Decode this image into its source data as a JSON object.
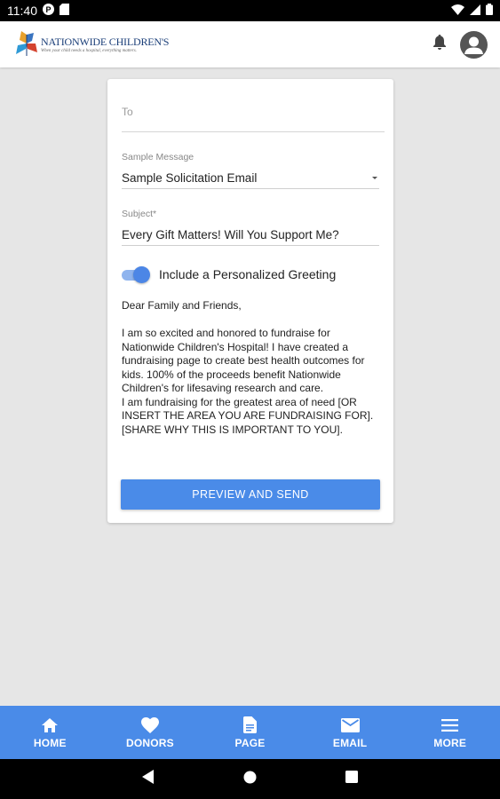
{
  "status_bar": {
    "time": "11:40"
  },
  "app_bar": {
    "logo_name": "NATIONWIDE CHILDREN'S",
    "logo_tagline": "When your child needs a hospital, everything matters."
  },
  "form": {
    "to_placeholder": "To",
    "sample_message_label": "Sample Message",
    "sample_message_value": "Sample Solicitation Email",
    "subject_label": "Subject",
    "subject_required_mark": "*",
    "subject_value": "Every Gift Matters! Will You Support Me?",
    "greeting_toggle_label": "Include a Personalized Greeting",
    "greeting_toggle_on": true,
    "message_greeting": "Dear Family and Friends,",
    "message_body_1": "I am so excited and honored to fundraise for Nationwide Children's Hospital! I have created a fundraising page to create best health outcomes for kids. 100% of the proceeds benefit Nationwide Children's for lifesaving research and care.",
    "message_body_2": "I am fundraising for the greatest area of need [OR INSERT THE AREA YOU ARE FUNDRAISING FOR]. [SHARE WHY THIS IS IMPORTANT TO YOU].",
    "preview_button": "PREVIEW AND SEND"
  },
  "bottom_nav": {
    "home": "HOME",
    "donors": "DONORS",
    "page": "PAGE",
    "email": "EMAIL",
    "more": "MORE"
  },
  "colors": {
    "accent": "#4a8be8",
    "background": "#e6e6e6",
    "card": "#ffffff"
  }
}
